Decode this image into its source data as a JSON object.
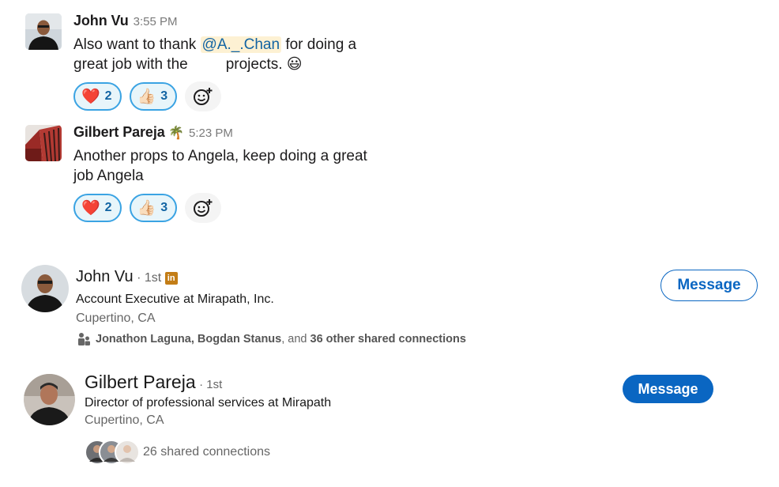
{
  "slack_messages": [
    {
      "author": "John Vu",
      "time": "3:55 PM",
      "text_before": "Also want to thank ",
      "mention": "@A._.Chan",
      "text_after_line1": " for doing a",
      "line2_start": "great job with the",
      "line2_end": "projects.",
      "emoji": "😃",
      "reactions": [
        {
          "emoji": "❤️",
          "count": "2",
          "name": "heart"
        },
        {
          "emoji": "👍🏻",
          "count": "3",
          "name": "thumbs-up"
        }
      ]
    },
    {
      "author": "Gilbert Pareja",
      "status_emoji": "🌴",
      "time": "5:23 PM",
      "line1": "Another props to Angela, keep doing a great",
      "line2": "job Angela",
      "reactions": [
        {
          "emoji": "❤️",
          "count": "2",
          "name": "heart"
        },
        {
          "emoji": "👍🏻",
          "count": "3",
          "name": "thumbs-up"
        }
      ]
    }
  ],
  "linkedin_cards": [
    {
      "name": "John Vu",
      "degree": "· 1st",
      "badge": "in",
      "headline": "Account Executive at Mirapath, Inc.",
      "location": "Cupertino, CA",
      "shared_names": "Jonathon Laguna, Bogdan Stanus",
      "shared_and": ", and ",
      "shared_count": "36 other shared connections",
      "button": "Message"
    },
    {
      "name": "Gilbert Pareja",
      "degree": "· 1st",
      "headline": "Director of professional services at Mirapath",
      "location": "Cupertino, CA",
      "shared": "26 shared connections",
      "button": "Message"
    }
  ],
  "colors": {
    "linkedin_blue": "#0a66c2",
    "slack_reaction_border": "#3aa3e3",
    "slack_reaction_bg": "#e8f5fa",
    "mention_bg": "#fdf1d3",
    "mention_text": "#1264a3"
  }
}
